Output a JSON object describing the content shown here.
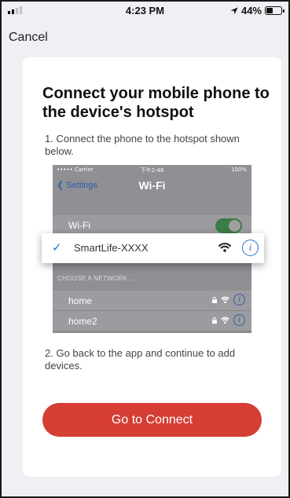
{
  "status_bar": {
    "time": "4:23 PM",
    "battery": "44%",
    "battery_level": 0.44
  },
  "header": {
    "cancel_label": "Cancel"
  },
  "card": {
    "title": "Connect your mobile phone to the device's hotspot",
    "step1": "1. Connect the phone to the hotspot shown below.",
    "step2": "2. Go back to the app and continue to add devices.",
    "button_label": "Go to Connect"
  },
  "illustration": {
    "carrier": "••••• Carrier",
    "time": "下午2:48",
    "battery": "100%",
    "back_label": "Settings",
    "title": "Wi-Fi",
    "wifi_label": "Wi-Fi",
    "selected_network": "SmartLife-XXXX",
    "choose_label": "CHOOSE A NETWORK...",
    "networks": [
      "home",
      "home2"
    ]
  },
  "colors": {
    "accent": "#d63d35",
    "ios_blue": "#2f6fd6",
    "background": "#efeff4"
  }
}
